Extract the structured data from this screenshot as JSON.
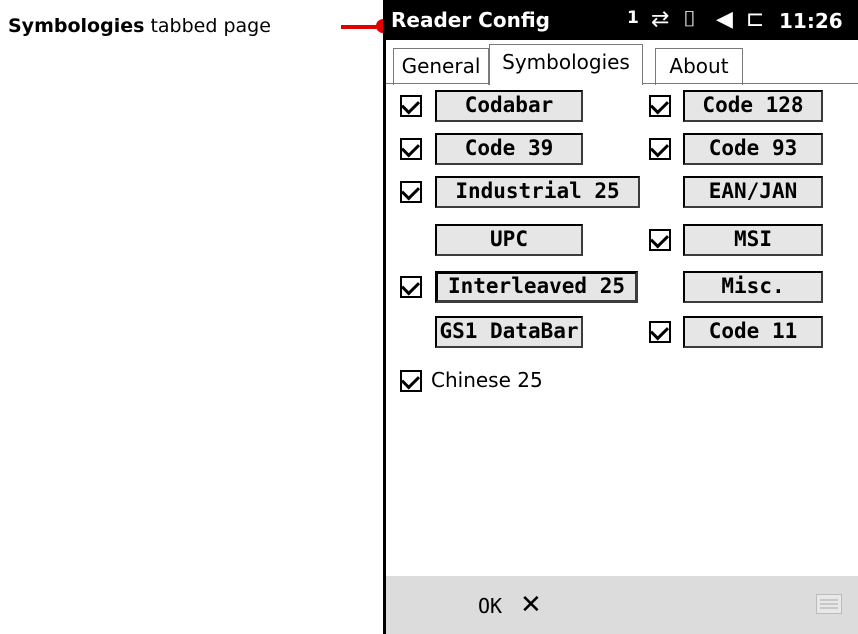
{
  "callout": {
    "bold": "Symbologies",
    "rest": " tabbed page"
  },
  "statusbar": {
    "app_title": "Reader Config",
    "count": "1",
    "time": "11:26"
  },
  "icons": {
    "connectivity": "connectivity-icon",
    "signal": "signal-icon",
    "speaker": "speaker-icon",
    "battery": "battery-charging-icon"
  },
  "tabs": [
    "General",
    "Symbologies",
    "About"
  ],
  "active_tab": "Symbologies",
  "symbologies": [
    {
      "label": "Codabar",
      "checked": true
    },
    {
      "label": "Code 128",
      "checked": true
    },
    {
      "label": "Code 39",
      "checked": true
    },
    {
      "label": "Code 93",
      "checked": true
    },
    {
      "label": "Industrial 25",
      "checked": true
    },
    {
      "label": "EAN/JAN",
      "checked": false
    },
    {
      "label": "UPC",
      "checked": false
    },
    {
      "label": "MSI",
      "checked": true
    },
    {
      "label": "Interleaved 25",
      "checked": true,
      "focused": true
    },
    {
      "label": "Misc.",
      "checked": false
    },
    {
      "label": "GS1 DataBar",
      "checked": false
    },
    {
      "label": "Code 11",
      "checked": true
    }
  ],
  "chinese": {
    "label": "Chinese 25",
    "checked": true
  },
  "bottombar": {
    "ok": "OK",
    "close": "✕"
  }
}
